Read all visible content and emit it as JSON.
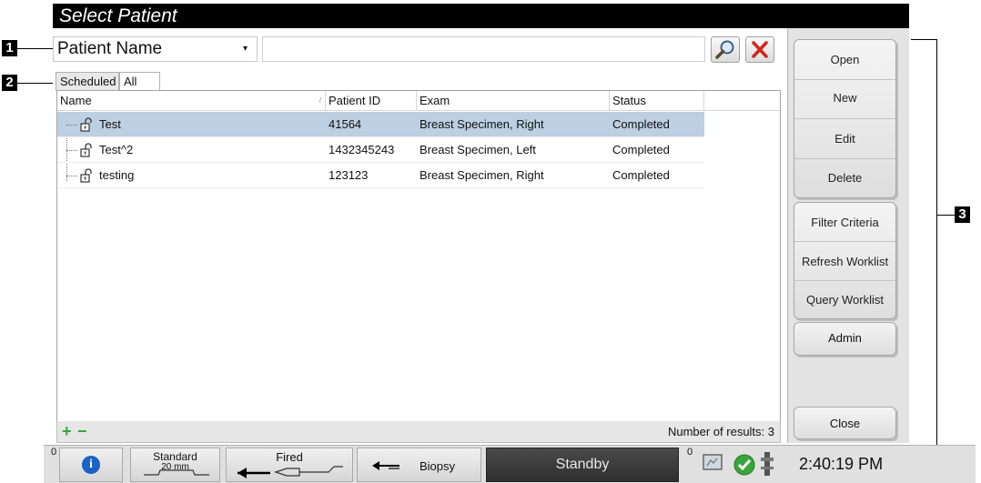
{
  "window": {
    "title": "Select Patient"
  },
  "callouts": [
    "1",
    "2",
    "3"
  ],
  "search": {
    "field_label": "Patient Name",
    "value": "",
    "search_icon": "magnifier-icon",
    "clear_icon": "red-x-icon"
  },
  "tabs": [
    {
      "label": "Scheduled"
    },
    {
      "label": "All"
    }
  ],
  "grid": {
    "columns": [
      "Name",
      "Patient ID",
      "Exam",
      "Status"
    ],
    "rows": [
      {
        "name": "Test",
        "patient_id": "41564",
        "exam": "Breast Specimen, Right",
        "status": "Completed",
        "selected": true
      },
      {
        "name": "Test^2",
        "patient_id": "1432345243",
        "exam": "Breast Specimen, Left",
        "status": "Completed",
        "selected": false
      },
      {
        "name": "testing",
        "patient_id": "123123",
        "exam": "Breast Specimen, Right",
        "status": "Completed",
        "selected": false
      }
    ],
    "footer_count": "Number of results: 3"
  },
  "side_buttons": {
    "group1": [
      "Open",
      "New",
      "Edit",
      "Delete"
    ],
    "group2": [
      "Filter Criteria",
      "Refresh Worklist",
      "Query Worklist"
    ],
    "admin": "Admin",
    "close": "Close"
  },
  "statusbar": {
    "info_count": "0",
    "paddle_name": "Standard",
    "paddle_size": "20 mm",
    "fired_label": "Fired",
    "biopsy_label": "Biopsy",
    "standby_label": "Standby",
    "output_count": "0",
    "clock": "2:40:19 PM"
  },
  "colors": {
    "selection": "#bccfe3",
    "title_bar": "#000000",
    "standby_bg": "#3a3a3a",
    "close_icon": "#d0281b",
    "info_icon": "#1a63c6",
    "check_icon": "#3aa53a"
  }
}
